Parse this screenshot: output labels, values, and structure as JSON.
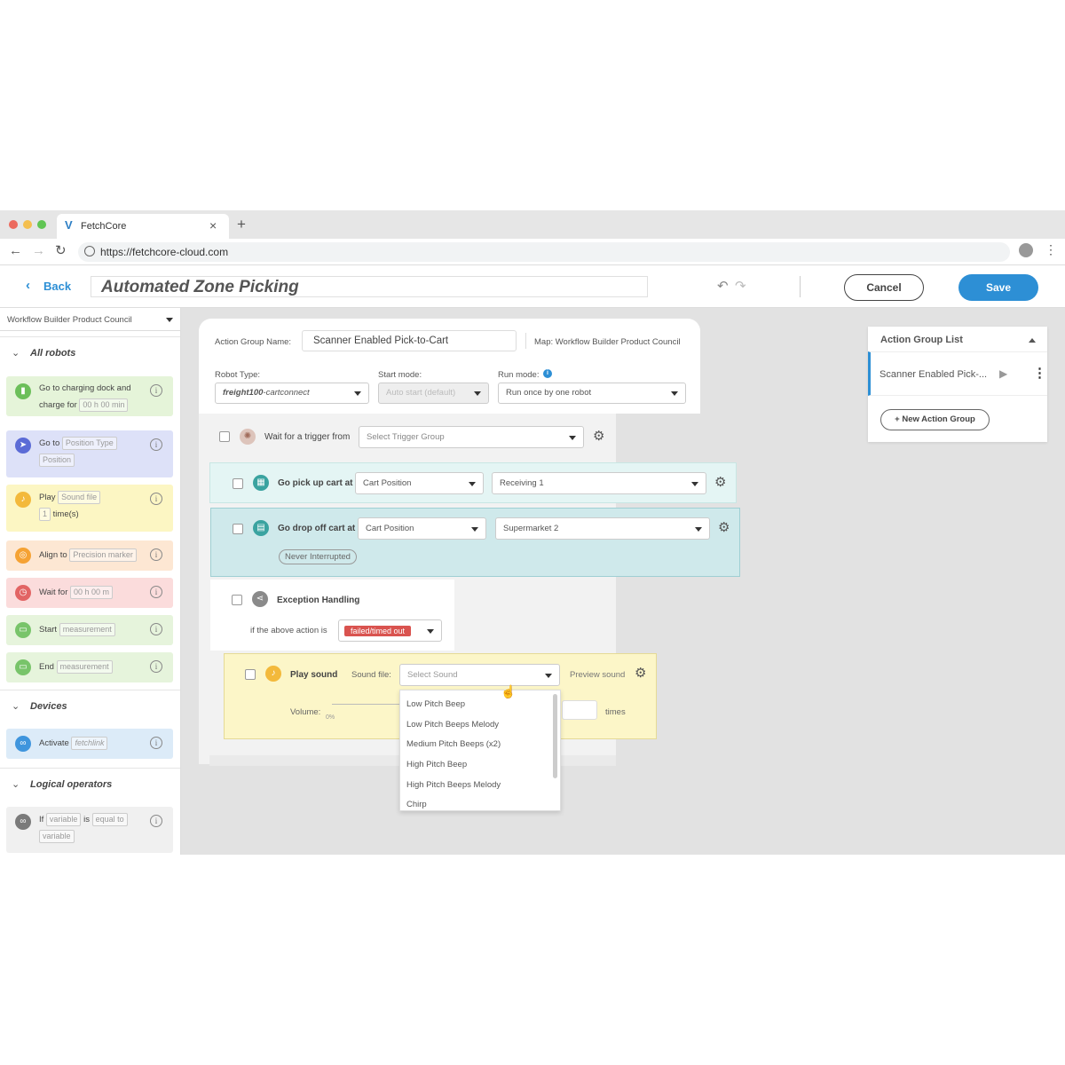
{
  "browser": {
    "tab_title": "FetchCore",
    "tab_close": "×",
    "new_tab": "+",
    "url": "https://fetchcore-cloud.com"
  },
  "header": {
    "back_label": "Back",
    "title": "Automated Zone Picking",
    "cancel_label": "Cancel",
    "save_label": "Save"
  },
  "sidebar": {
    "workspace": "Workflow Builder Product Council",
    "sections": {
      "all_robots": "All robots",
      "devices": "Devices",
      "logical_operators": "Logical operators"
    },
    "cards": {
      "charging": {
        "line1": "Go to charging dock and",
        "charge_for": "charge for",
        "time": "00 h 00 min"
      },
      "goto": {
        "label": "Go to",
        "chip1": "Position Type",
        "chip2": "Position"
      },
      "play": {
        "label": "Play",
        "chip1": "Sound file",
        "count": "1",
        "suffix": "time(s)"
      },
      "align": {
        "label": "Align to",
        "chip1": "Precision marker"
      },
      "wait": {
        "label": "Wait for",
        "chip1": "00 h 00 m"
      },
      "start": {
        "label": "Start",
        "chip1": "measurement"
      },
      "end": {
        "label": "End",
        "chip1": "measurement"
      },
      "activate": {
        "label": "Activate",
        "chip1": "fetchlink"
      },
      "ifop": {
        "label": "If",
        "chip1": "variable",
        "is": "is",
        "chip2": "equal to",
        "chip3": "variable"
      }
    }
  },
  "action_group": {
    "name_label": "Action Group Name:",
    "name_value": "Scanner Enabled Pick-to-Cart",
    "map_label": "Map: Workflow Builder Product Council",
    "robot_type_label": "Robot Type:",
    "robot_type_bold": "freight100",
    "robot_type_rest": "-cartconnect",
    "start_mode_label": "Start mode:",
    "start_mode_value": "Auto start (default)",
    "run_mode_label": "Run mode:",
    "run_mode_value": "Run once by one robot"
  },
  "blocks": {
    "trigger": {
      "label": "Wait for a trigger from",
      "select": "Select Trigger Group"
    },
    "pickup": {
      "label": "Go pick up cart at",
      "select1": "Cart Position",
      "select2": "Receiving 1"
    },
    "dropoff": {
      "label": "Go drop off cart at",
      "select1": "Cart Position",
      "select2": "Supermarket 2",
      "chip": "Never Interrupted"
    },
    "exception": {
      "label": "Exception Handling",
      "condition": "if the above action is",
      "status": "failed/timed out"
    },
    "play_sound": {
      "label": "Play sound",
      "sound_file_label": "Sound file:",
      "sound_placeholder": "Select Sound",
      "preview": "Preview sound",
      "volume_label": "Volume:",
      "volume_value": "0%",
      "times": "times"
    }
  },
  "sound_options": [
    "Low Pitch Beep",
    "Low Pitch Beeps Melody",
    "Medium Pitch Beeps (x2)",
    "High Pitch Beep",
    "High Pitch Beeps Melody",
    "Chirp"
  ],
  "action_group_list": {
    "title": "Action Group List",
    "item": "Scanner Enabled Pick-...",
    "new_group": "+ New Action Group"
  },
  "colors": {
    "save_blue": "#2d8fd5",
    "pickup_teal": "#e4f5f4",
    "dropoff_teal": "#cfe9eb",
    "sound_yellow": "#fcf6c8",
    "danger_red": "#d9534f"
  }
}
